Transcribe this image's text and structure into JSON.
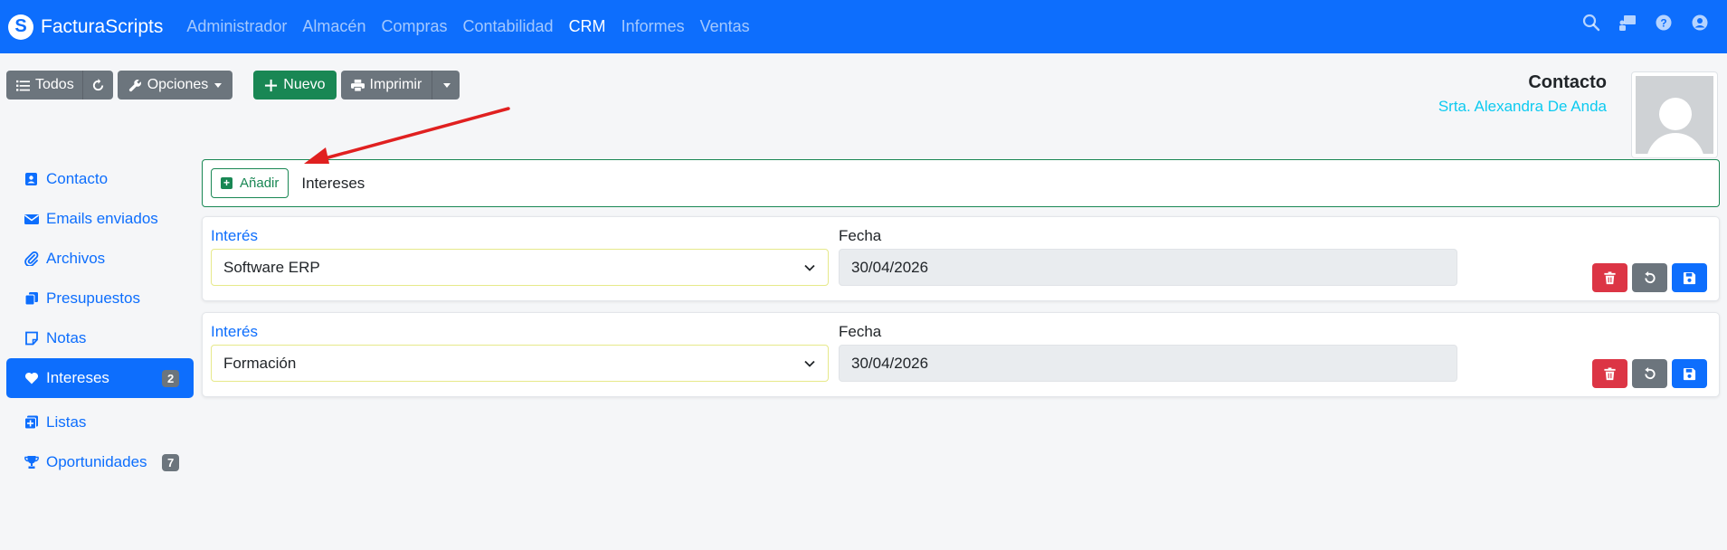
{
  "navbar": {
    "brand": "FacturaScripts",
    "menu": [
      {
        "label": "Administrador",
        "active": false
      },
      {
        "label": "Almacén",
        "active": false
      },
      {
        "label": "Compras",
        "active": false
      },
      {
        "label": "Contabilidad",
        "active": false
      },
      {
        "label": "CRM",
        "active": true
      },
      {
        "label": "Informes",
        "active": false
      },
      {
        "label": "Ventas",
        "active": false
      }
    ]
  },
  "toolbar": {
    "all_label": "Todos",
    "options_label": "Opciones",
    "new_label": "Nuevo",
    "print_label": "Imprimir"
  },
  "header": {
    "title": "Contacto",
    "name": "Srta. Alexandra De Anda"
  },
  "sidebar": {
    "items": [
      {
        "label": "Contacto",
        "icon": "contact-card-icon",
        "badge": ""
      },
      {
        "label": "Emails enviados",
        "icon": "envelope-icon",
        "badge": ""
      },
      {
        "label": "Archivos",
        "icon": "paperclip-icon",
        "badge": ""
      },
      {
        "label": "Presupuestos",
        "icon": "copy-icon",
        "badge": ""
      },
      {
        "label": "Notas",
        "icon": "note-icon",
        "badge": ""
      },
      {
        "label": "Intereses",
        "icon": "heart-icon",
        "badge": "2",
        "active": true
      },
      {
        "label": "Listas",
        "icon": "list-plus-icon",
        "badge": ""
      },
      {
        "label": "Oportunidades",
        "icon": "trophy-icon",
        "badge": "7"
      }
    ]
  },
  "main": {
    "add_button": "Añadir",
    "section_title": "Intereses",
    "rows": [
      {
        "interest_label": "Interés",
        "interest_value": "Software ERP",
        "date_label": "Fecha",
        "date_value": "30/04/2026"
      },
      {
        "interest_label": "Interés",
        "interest_value": "Formación",
        "date_label": "Fecha",
        "date_value": "30/04/2026"
      }
    ]
  },
  "colors": {
    "primary": "#0d6efd",
    "success": "#198754",
    "danger": "#dc3545",
    "secondary": "#6c757d",
    "info": "#0dcaf0"
  }
}
